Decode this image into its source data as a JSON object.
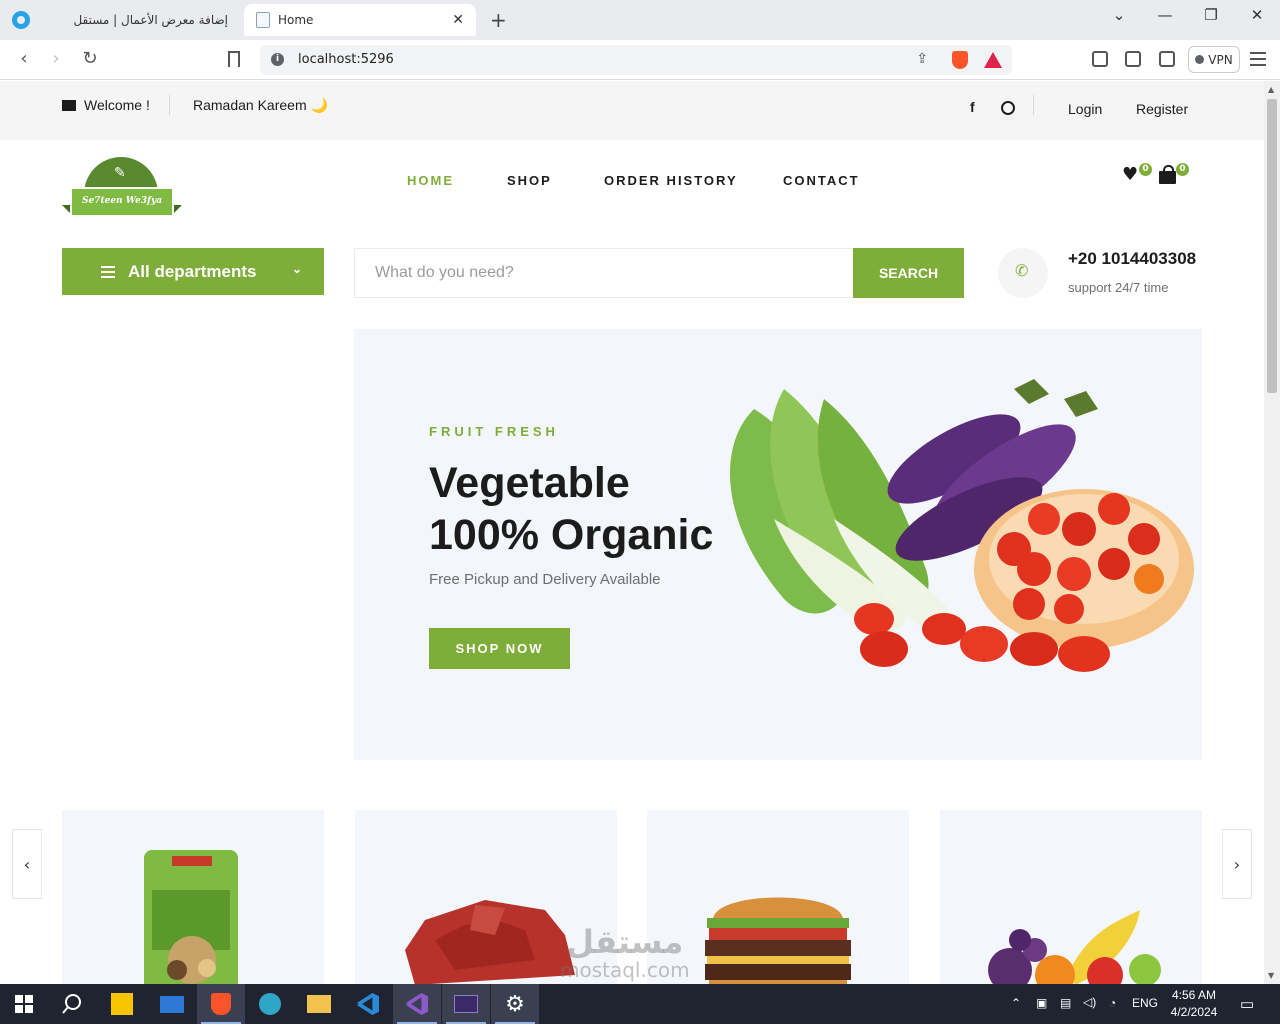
{
  "browser": {
    "tabs": [
      {
        "title": "إضافة معرض الأعمال | مستقل",
        "active": false
      },
      {
        "title": "Home",
        "active": true
      }
    ],
    "url": "localhost:5296",
    "vpn_label": "VPN",
    "new_tab_symbol": "+",
    "close_symbol": "✕"
  },
  "topbar": {
    "welcome": "Welcome !",
    "ramadan": "Ramadan Kareem 🌙",
    "login": "Login",
    "register": "Register",
    "facebook_icon": "f"
  },
  "logo": {
    "text": "Se7teen We3fya"
  },
  "nav": {
    "items": [
      {
        "label": "HOME",
        "active": true
      },
      {
        "label": "SHOP",
        "active": false
      },
      {
        "label": "ORDER HISTORY",
        "active": false
      },
      {
        "label": "CONTACT",
        "active": false
      }
    ]
  },
  "header_icons": {
    "wishlist_count": "0",
    "cart_count": "0"
  },
  "departments": {
    "label": "All departments"
  },
  "search": {
    "placeholder": "What do you need?",
    "button": "SEARCH"
  },
  "contact": {
    "phone": "+20 1014403308",
    "support": "support 24/7 time"
  },
  "hero": {
    "eyebrow": "FRUIT FRESH",
    "title_line1": "Vegetable",
    "title_line2": "100% Organic",
    "subtitle": "Free Pickup and Delivery Available",
    "cta": "SHOP NOW"
  },
  "categories": {
    "cards": [
      {
        "image": "dried-fruit-package"
      },
      {
        "image": "raw-meat"
      },
      {
        "image": "burger"
      },
      {
        "image": "fruits"
      }
    ],
    "prev_symbol": "‹",
    "next_symbol": "›"
  },
  "watermark": {
    "arabic": "مستقل",
    "latin": "mostaql.com"
  },
  "taskbar": {
    "tray_lang": "ENG",
    "time": "4:56 AM",
    "date": "4/2/2024"
  },
  "colors": {
    "accent": "#7fad39",
    "hero_bg": "#f3f6fa",
    "topbar_bg": "#f5f5f5"
  }
}
